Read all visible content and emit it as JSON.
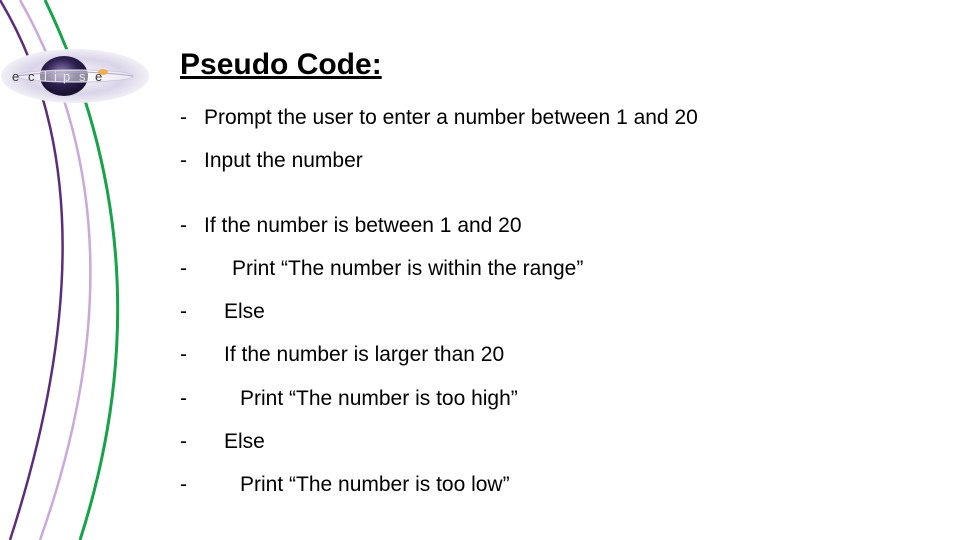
{
  "title": "Pseudo Code:",
  "eclipse_word": "eclipse",
  "lines": [
    "Prompt the user to enter a number between 1 and 20",
    "Input the number",
    "If the number is between 1 and 20",
    "Print “The number is within the range”",
    "Else",
    "If the number is larger than 20",
    "Print “The number is too high”",
    "Else",
    "Print “The number is too low”"
  ]
}
